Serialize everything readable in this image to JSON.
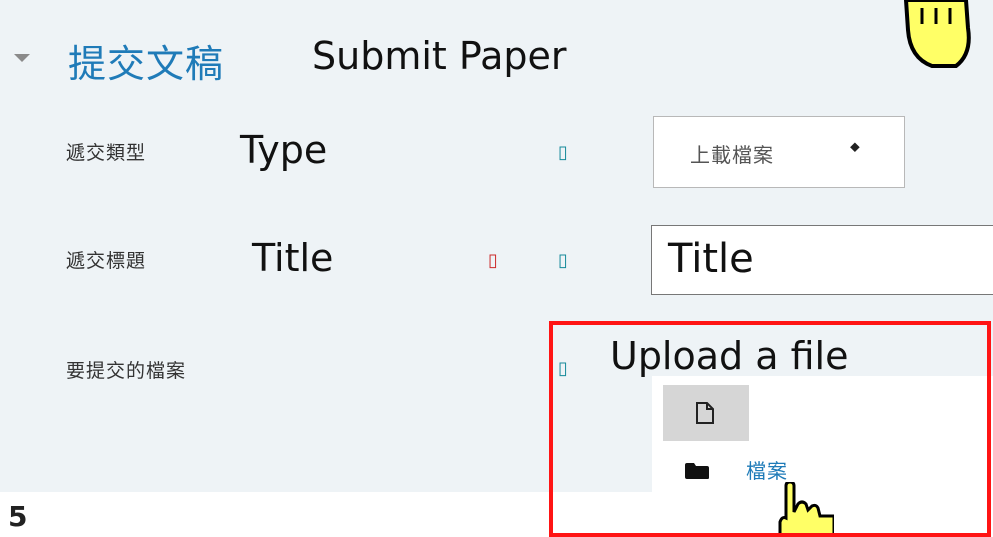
{
  "section": {
    "title_zh": "提交文稿",
    "title_en": "Submit Paper"
  },
  "fields": {
    "type": {
      "label_zh": "遞交類型",
      "label_en": "Type",
      "info_glyph": "▯",
      "select_value": "上載檔案",
      "select_arrow": "⬥"
    },
    "title": {
      "label_zh": "遞交標題",
      "label_en": "Title",
      "required_glyph": "▯",
      "info_glyph": "▯",
      "input_value": "Title"
    },
    "file": {
      "label_zh": "要提交的檔案",
      "info_glyph": "▯",
      "upload_label": "Upload a file",
      "folder_label": "檔案"
    }
  },
  "footer": {
    "page_number": "5"
  },
  "icons": [
    "chevron-down-icon",
    "info-icon",
    "required-icon",
    "sort-arrows-icon",
    "file-icon",
    "folder-icon",
    "hand-pointer-icon"
  ],
  "colors": {
    "link": "#1f7bb8",
    "info": "#168a9a",
    "required": "#cc2b2b",
    "highlight": "#ff1414",
    "panel_bg": "#eef3f6"
  }
}
